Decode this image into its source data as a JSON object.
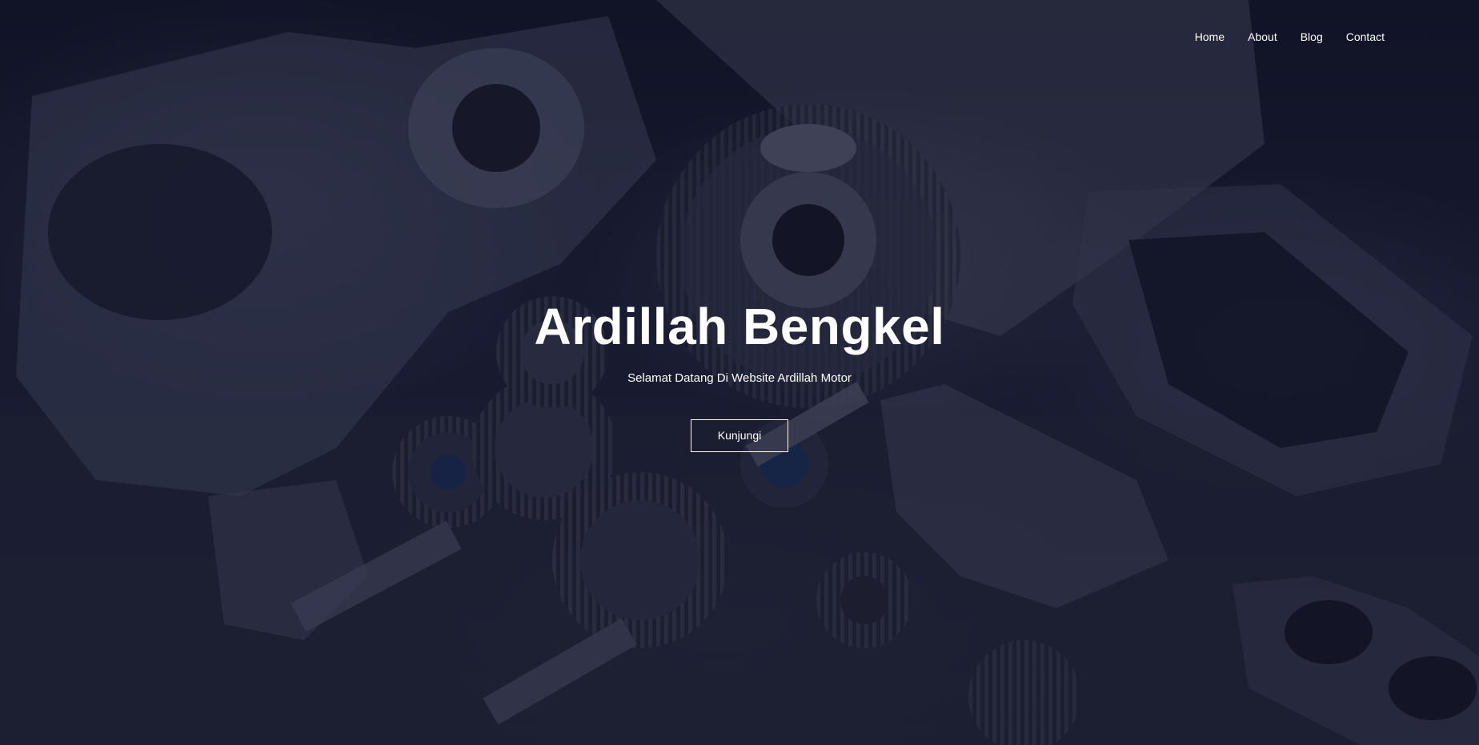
{
  "nav": {
    "items": [
      {
        "label": "Home"
      },
      {
        "label": "About"
      },
      {
        "label": "Blog"
      },
      {
        "label": "Contact"
      }
    ]
  },
  "hero": {
    "title": "Ardillah Bengkel",
    "subtitle": "Selamat Datang Di Website Ardillah Motor",
    "button_label": "Kunjungi",
    "background_image": "gearbox-parts-photo",
    "overlay_color": "#0c0e26"
  }
}
